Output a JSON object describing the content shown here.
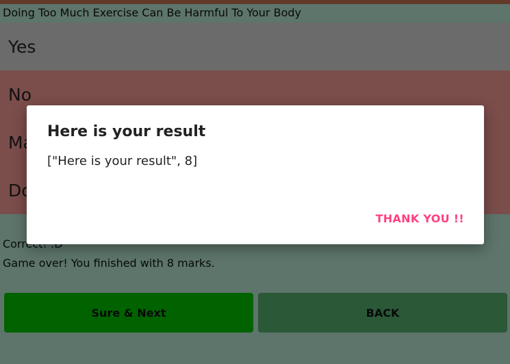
{
  "question": "Doing Too Much Exercise Can Be Harmful To Your Body",
  "options": [
    {
      "label": "Yes"
    },
    {
      "label": "No"
    },
    {
      "label": "Ma"
    },
    {
      "label": "Do"
    }
  ],
  "status": {
    "correct": "Correct! :D",
    "game_over": "Game over! You finished with 8 marks."
  },
  "buttons": {
    "next": "Sure & Next",
    "back": "BACK"
  },
  "dialog": {
    "title": "Here is your result",
    "message": "[\"Here is your result\", 8]",
    "action": "THANK YOU !!"
  },
  "colors": {
    "background": "#a9d6c1",
    "option_selected": "#c4c4c4",
    "option_wrong": "#e08c89",
    "next_button": "#00b400",
    "back_button": "#4fa266",
    "dialog_action": "#ff4081"
  }
}
